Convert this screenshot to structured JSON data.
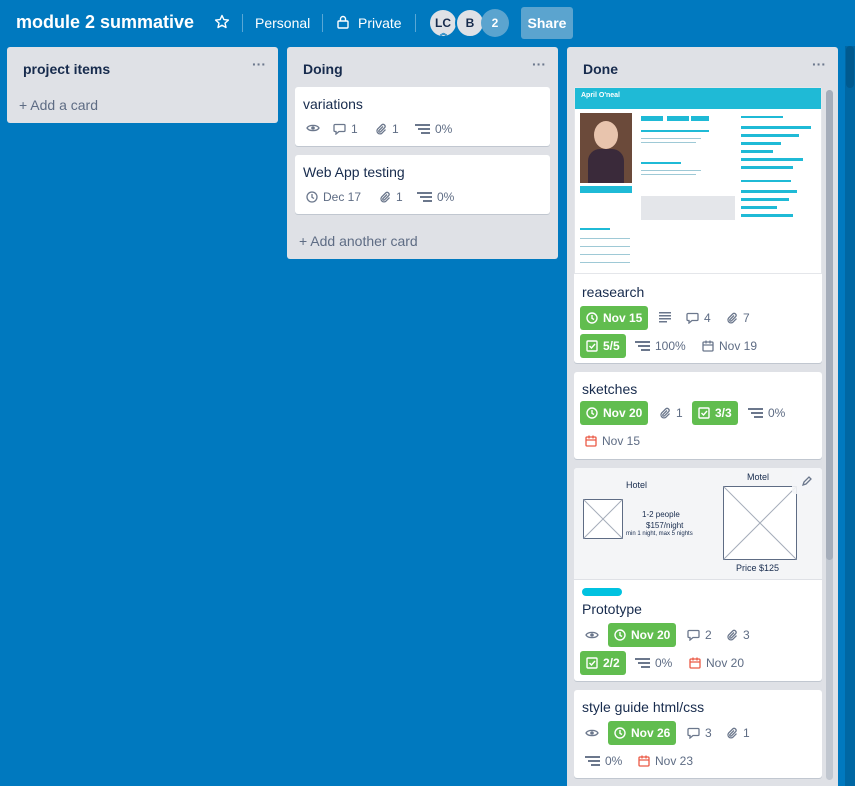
{
  "header": {
    "board_title": "module 2 summative",
    "team": "Personal",
    "visibility": "Private",
    "members": [
      "LC",
      "B"
    ],
    "member_overflow": "2",
    "share_label": "Share"
  },
  "lists": {
    "project_items": {
      "title": "project items",
      "menu": "···",
      "add_label": "+ Add a card"
    },
    "doing": {
      "title": "Doing",
      "menu": "···",
      "add_label": "+ Add another card"
    },
    "done": {
      "title": "Done",
      "menu": "···"
    }
  },
  "doing_cards": {
    "variations": {
      "title": "variations",
      "comments": "1",
      "attachments": "1",
      "progress": "0%"
    },
    "webapp": {
      "title": "Web App testing",
      "due": "Dec 17",
      "attachments": "1",
      "progress": "0%"
    }
  },
  "done_cards": {
    "persona": {
      "cover_name": "April O'neal",
      "title": "reasearch",
      "due": "Nov 15",
      "comments": "4",
      "attachments": "7",
      "checklist": "5/5",
      "progress": "100%",
      "date": "Nov 19"
    },
    "sketches": {
      "title": "sketches",
      "due": "Nov 20",
      "attachments": "1",
      "checklist": "3/3",
      "progress": "0%",
      "date": "Nov 15"
    },
    "prototype": {
      "cover": {
        "hotel": "Hotel",
        "motel": "Motel",
        "people": "1-2 people",
        "price_night": "$157/night",
        "min_night": "min 1 night, max 5 nights",
        "price": "Price $125"
      },
      "label_color": "#00c2e0",
      "title": "Prototype",
      "due": "Nov 20",
      "comments": "2",
      "attachments": "3",
      "checklist": "2/2",
      "progress": "0%",
      "date": "Nov 20"
    },
    "styleguide": {
      "title": "style guide html/css",
      "due": "Nov 26",
      "comments": "3",
      "attachments": "1",
      "progress": "0%",
      "date": "Nov 23"
    }
  },
  "colors": {
    "board_bg": "#0079bf",
    "green": "#61bd4f",
    "label_cyan": "#00c2e0",
    "red_date": "#eb5a46"
  }
}
